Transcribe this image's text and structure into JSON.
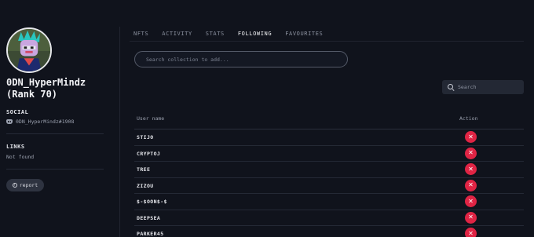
{
  "profile": {
    "username": "0DN_HyperMindz (Rank 70)",
    "social_title": "SOCIAL",
    "discord_handle": "0DN_HyperMindz#1908",
    "links_title": "LINKS",
    "links_value": "Not found",
    "report_label": "report"
  },
  "tabs": [
    "NFTS",
    "ACTIVITY",
    "STATS",
    "FOLLOWING",
    "FAVOURITES"
  ],
  "active_tab": "FOLLOWING",
  "collection_search": {
    "placeholder": "Search collection to add..."
  },
  "table_search": {
    "placeholder": "Search"
  },
  "table": {
    "columns": {
      "username": "User name",
      "action": "Action"
    },
    "rows": [
      {
        "name": "STIJO"
      },
      {
        "name": "CRYPTOJ"
      },
      {
        "name": "TREE"
      },
      {
        "name": "ZIZOU"
      },
      {
        "name": "$-$OON$-$"
      },
      {
        "name": "DEEPSEA"
      },
      {
        "name": "PARKER45"
      }
    ],
    "action_icon": "close-icon"
  },
  "colors": {
    "background": "#10131c",
    "remove_button": "#e02444",
    "active_tab": "#f0f1f4"
  }
}
